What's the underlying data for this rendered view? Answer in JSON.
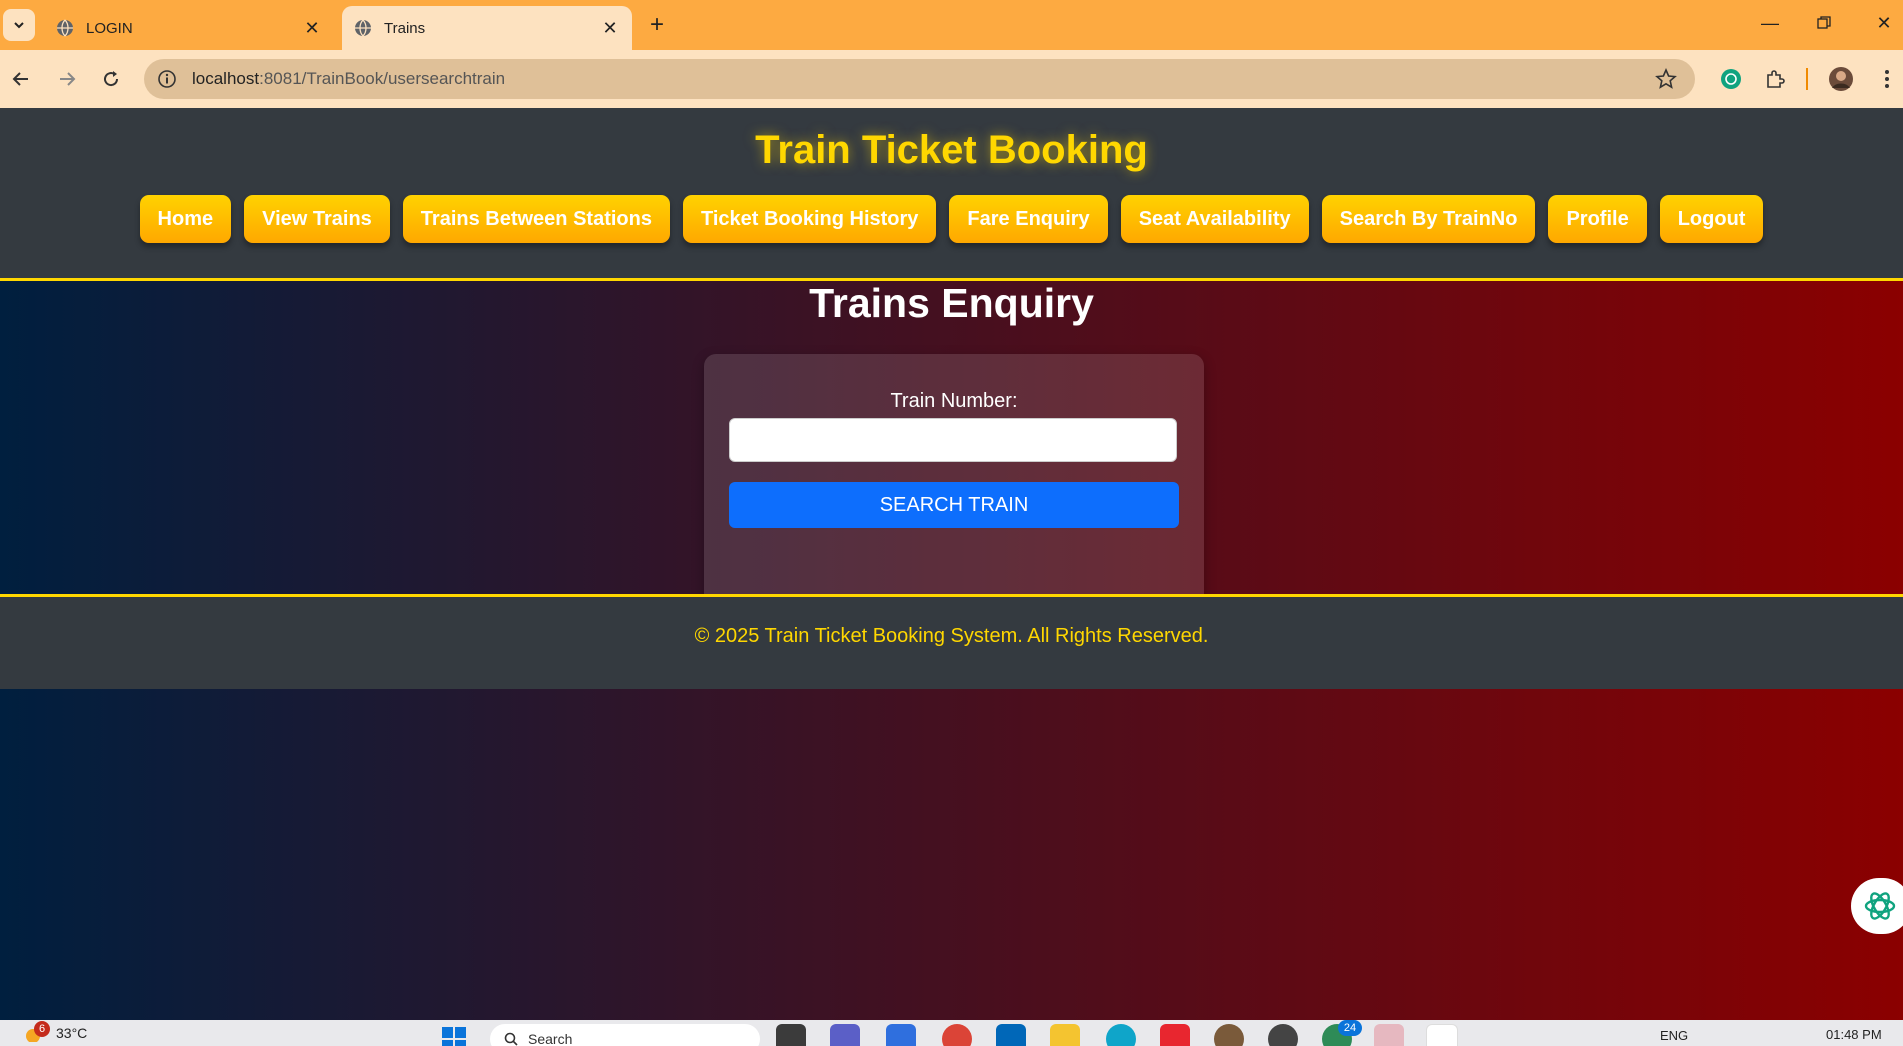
{
  "browser": {
    "tabs": [
      {
        "title": "LOGIN",
        "active": false
      },
      {
        "title": "Trains",
        "active": true
      }
    ],
    "url_host": "localhost",
    "url_path": ":8081/TrainBook/usersearchtrain"
  },
  "site": {
    "title": "Train Ticket Booking",
    "menu": [
      "Home",
      "View Trains",
      "Trains Between Stations",
      "Ticket Booking History",
      "Fare Enquiry",
      "Seat Availability",
      "Search By TrainNo",
      "Profile",
      "Logout"
    ],
    "accent_color": "#ffd700",
    "button_color": "#0d6efd"
  },
  "page": {
    "heading": "Trains Enquiry",
    "form": {
      "label": "Train Number:",
      "value": "",
      "submit": "SEARCH TRAIN"
    }
  },
  "footer": {
    "text": "© 2025 Train Ticket Booking System. All Rights Reserved."
  },
  "taskbar": {
    "weather": "33°C",
    "weather_badge": "6",
    "search_placeholder": "Search",
    "app_badge": "24",
    "language": "ENG",
    "time": "01:48 PM"
  }
}
